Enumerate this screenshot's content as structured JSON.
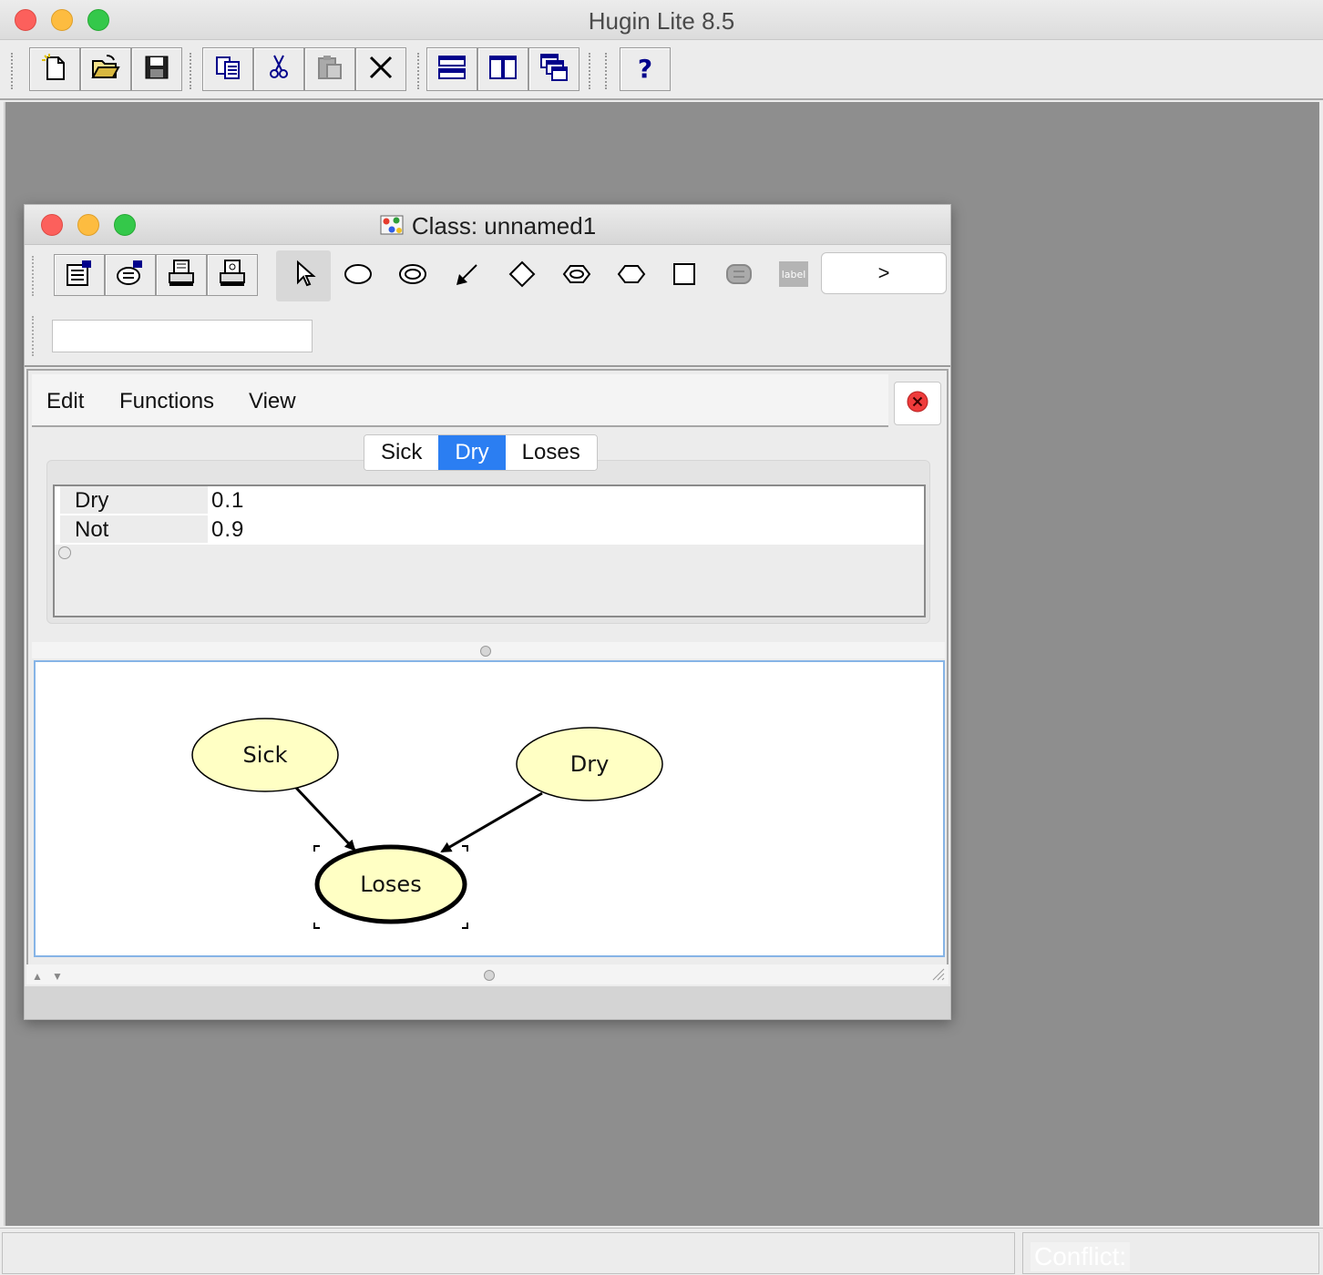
{
  "main_window": {
    "title": "Hugin Lite 8.5",
    "toolbar": [
      "new-file-icon",
      "open-folder-icon",
      "save-icon",
      "copy-icon",
      "cut-icon",
      "paste-icon",
      "delete-icon",
      "tile-horizontal-icon",
      "tile-vertical-icon",
      "cascade-icon",
      "help-icon"
    ],
    "status": {
      "conflict_label": "Conflict:"
    }
  },
  "class_window": {
    "title": "Class: unnamed1",
    "toolbar": {
      "buttons": [
        "network-properties-icon",
        "node-properties-icon",
        "print-icon",
        "print-preview-icon"
      ],
      "tools": [
        "select-tool-icon",
        "chance-node-tool-icon",
        "discrete-function-node-tool-icon",
        "link-tool-icon",
        "decision-node-tool-icon",
        "instance-tool-icon",
        "utility-node-tool-icon",
        "rectangle-tool-icon",
        "function-node-tool-icon",
        "label-tool-icon"
      ],
      "more_label": ">",
      "name_field_value": ""
    },
    "menu": {
      "edit": "Edit",
      "functions": "Functions",
      "view": "View"
    },
    "tabs": [
      {
        "label": "Sick",
        "active": false
      },
      {
        "label": "Dry",
        "active": true
      },
      {
        "label": "Loses",
        "active": false
      }
    ],
    "table": {
      "rows": [
        {
          "state": "Dry",
          "value": "0.1"
        },
        {
          "state": "Not",
          "value": "0.9"
        }
      ]
    },
    "graph": {
      "nodes": [
        {
          "id": "sick",
          "label": "Sick",
          "selected": false
        },
        {
          "id": "dry",
          "label": "Dry",
          "selected": false
        },
        {
          "id": "loses",
          "label": "Loses",
          "selected": true
        }
      ],
      "edges": [
        {
          "from": "Sick",
          "to": "Loses"
        },
        {
          "from": "Dry",
          "to": "Loses"
        }
      ],
      "node_fill": "#ffffc4"
    }
  }
}
